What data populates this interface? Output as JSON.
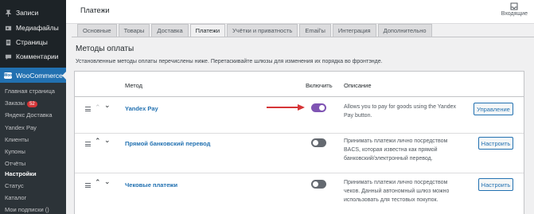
{
  "sidebar": {
    "menu": [
      {
        "label": "Записи",
        "icon": "pushpin-icon"
      },
      {
        "label": "Медиафайлы",
        "icon": "media-icon"
      },
      {
        "label": "Страницы",
        "icon": "pages-icon"
      },
      {
        "label": "Комментарии",
        "icon": "comments-icon"
      }
    ],
    "woocommerce_label": "WooCommerce",
    "submenu": [
      "Главная страница",
      "Заказы",
      "Яндекс Доставка",
      "Yandex Pay",
      "Клиенты",
      "Купоны",
      "Отчёты",
      "Настройки",
      "Статус",
      "Каталог",
      "Мои подписки ()"
    ],
    "orders_badge": "52",
    "current_item": "Настройки"
  },
  "header": {
    "title": "Платежи",
    "inbox_label": "Входящие"
  },
  "tabs": [
    "Основные",
    "Товары",
    "Доставка",
    "Платежи",
    "Учётки и приватность",
    "Email'ы",
    "Интеграция",
    "Дополнительно"
  ],
  "active_tab": "Платежи",
  "section": {
    "title": "Методы оплаты",
    "description": "Установленные методы оплаты перечислены ниже. Перетаскивайте шлюзы для изменения их порядка во фронтэнде."
  },
  "table": {
    "headers": {
      "method": "Метод",
      "enabled": "Включить",
      "description": "Описание"
    },
    "rows": [
      {
        "name": "Yandex Pay",
        "enabled": true,
        "description": "Allows you to pay for goods using the Yandex Pay button.",
        "action": "Управление"
      },
      {
        "name": "Прямой банковский перевод",
        "enabled": false,
        "description": "Принимать платежи лично посредством BACS, которая известна как прямой банковский/электронный перевод.",
        "action": "Настроить"
      },
      {
        "name": "Чековые платежи",
        "enabled": false,
        "description": "Принимать платежи лично посредством чеков. Данный автономный шлюз можно использовать для тестовых покупок.",
        "action": "Настроить"
      }
    ]
  },
  "colors": {
    "sidebar_bg": "#1d2327",
    "accent": "#2271b1",
    "toggle_on": "#7f54b3",
    "annotation": "#d63638"
  }
}
